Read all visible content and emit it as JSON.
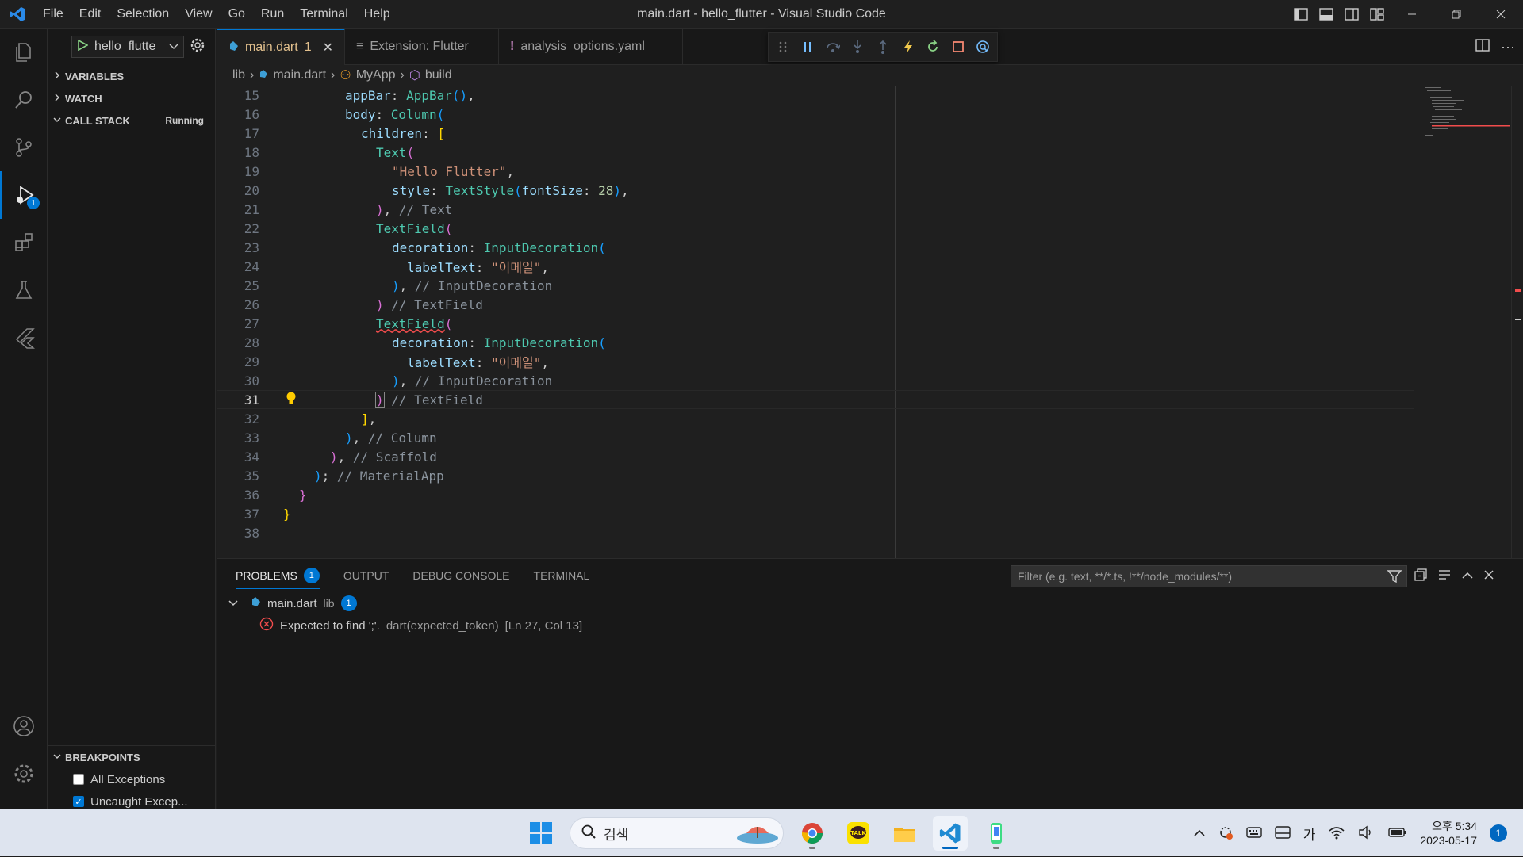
{
  "app": {
    "window_title": "main.dart - hello_flutter - Visual Studio Code",
    "menu": [
      "File",
      "Edit",
      "Selection",
      "View",
      "Go",
      "Run",
      "Terminal",
      "Help"
    ]
  },
  "activity_bar": {
    "run_debug_badge": "1"
  },
  "sidebar": {
    "launch_config": "hello_flutte",
    "sections": {
      "variables": "VARIABLES",
      "watch": "WATCH",
      "call_stack": "CALL STACK",
      "call_stack_status": "Running",
      "breakpoints": "BREAKPOINTS"
    },
    "breakpoints": [
      {
        "label": "All Exceptions",
        "checked": false
      },
      {
        "label": "Uncaught Excep...",
        "checked": true
      }
    ]
  },
  "tabs": [
    {
      "label": "main.dart",
      "badge": "1",
      "active": true
    },
    {
      "label": "Extension: Flutter",
      "active": false
    },
    {
      "label": "analysis_options.yaml",
      "active": false
    }
  ],
  "breadcrumb": [
    "lib",
    "main.dart",
    "MyApp",
    "build"
  ],
  "editor": {
    "current_line": 31,
    "lines": [
      {
        "n": "15",
        "code": "appBar: AppBar(),"
      },
      {
        "n": "16",
        "code": "body: Column("
      },
      {
        "n": "17",
        "code": "children: ["
      },
      {
        "n": "18",
        "code": "Text("
      },
      {
        "n": "19",
        "code": "\"Hello Flutter\","
      },
      {
        "n": "20",
        "code": "style: TextStyle(fontSize: 28),"
      },
      {
        "n": "21",
        "code": "), // Text"
      },
      {
        "n": "22",
        "code": "TextField("
      },
      {
        "n": "23",
        "code": "decoration: InputDecoration("
      },
      {
        "n": "24",
        "code": "labelText: \"이메일\","
      },
      {
        "n": "25",
        "code": "), // InputDecoration"
      },
      {
        "n": "26",
        "code": ") // TextField"
      },
      {
        "n": "27",
        "code": "TextField("
      },
      {
        "n": "28",
        "code": "decoration: InputDecoration("
      },
      {
        "n": "29",
        "code": "labelText: \"이메일\","
      },
      {
        "n": "30",
        "code": "), // InputDecoration"
      },
      {
        "n": "31",
        "code": ") // TextField"
      },
      {
        "n": "32",
        "code": "],"
      },
      {
        "n": "33",
        "code": "), // Column"
      },
      {
        "n": "34",
        "code": "), // Scaffold"
      },
      {
        "n": "35",
        "code": "); // MaterialApp"
      },
      {
        "n": "36",
        "code": "}"
      },
      {
        "n": "37",
        "code": "}"
      },
      {
        "n": "38",
        "code": ""
      }
    ]
  },
  "panel": {
    "tabs": [
      "PROBLEMS",
      "OUTPUT",
      "DEBUG CONSOLE",
      "TERMINAL"
    ],
    "problems_count": "1",
    "filter_placeholder": "Filter (e.g. text, **/*.ts, !**/node_modules/**)",
    "file": {
      "name": "main.dart",
      "folder": "lib",
      "count": "1"
    },
    "problem": {
      "message": "Expected to find ';'.",
      "source": "dart(expected_token)",
      "location": "[Ln 27, Col 13]"
    }
  },
  "taskbar": {
    "search_placeholder": "검색",
    "ime": "가",
    "time": "오후 5:34",
    "date": "2023-05-17",
    "notifications": "1"
  },
  "colors": {
    "accent": "#0078d4",
    "error": "#f14c4c",
    "modified_tab": "#e2c08d"
  }
}
